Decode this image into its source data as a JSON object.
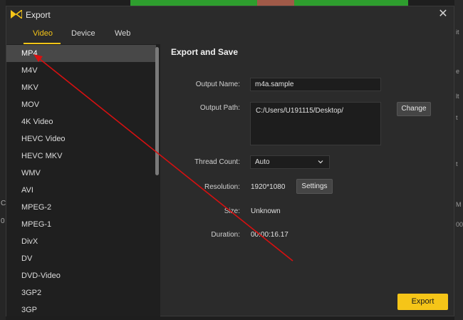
{
  "background": {
    "right_hints": [
      "it",
      "e",
      "lt",
      "t",
      "t",
      "M",
      "00"
    ],
    "left_hints": [
      "C",
      "0"
    ]
  },
  "dialog": {
    "title": "Export",
    "close_glyph": "✕"
  },
  "tabs": [
    {
      "label": "Video",
      "active": true
    },
    {
      "label": "Device",
      "active": false
    },
    {
      "label": "Web",
      "active": false
    }
  ],
  "formats": [
    "MP4",
    "M4V",
    "MKV",
    "MOV",
    "4K Video",
    "HEVC Video",
    "HEVC MKV",
    "WMV",
    "AVI",
    "MPEG-2",
    "MPEG-1",
    "DivX",
    "DV",
    "DVD-Video",
    "3GP2",
    "3GP"
  ],
  "selected_format": "MP4",
  "export_settings": {
    "section_title": "Export and Save",
    "output_name_label": "Output Name:",
    "output_name_value": "m4a.sample",
    "output_path_label": "Output Path:",
    "output_path_value": "C:/Users/U191115/Desktop/",
    "change_label": "Change",
    "thread_count_label": "Thread Count:",
    "thread_count_value": "Auto",
    "resolution_label": "Resolution:",
    "resolution_value": "1920*1080",
    "settings_label": "Settings",
    "size_label": "Size:",
    "size_value": "Unknown",
    "duration_label": "Duration:",
    "duration_value": "00:00:16.17",
    "export_label": "Export"
  },
  "colors": {
    "accent": "#f5c518",
    "annotation_arrow": "#d81010"
  }
}
